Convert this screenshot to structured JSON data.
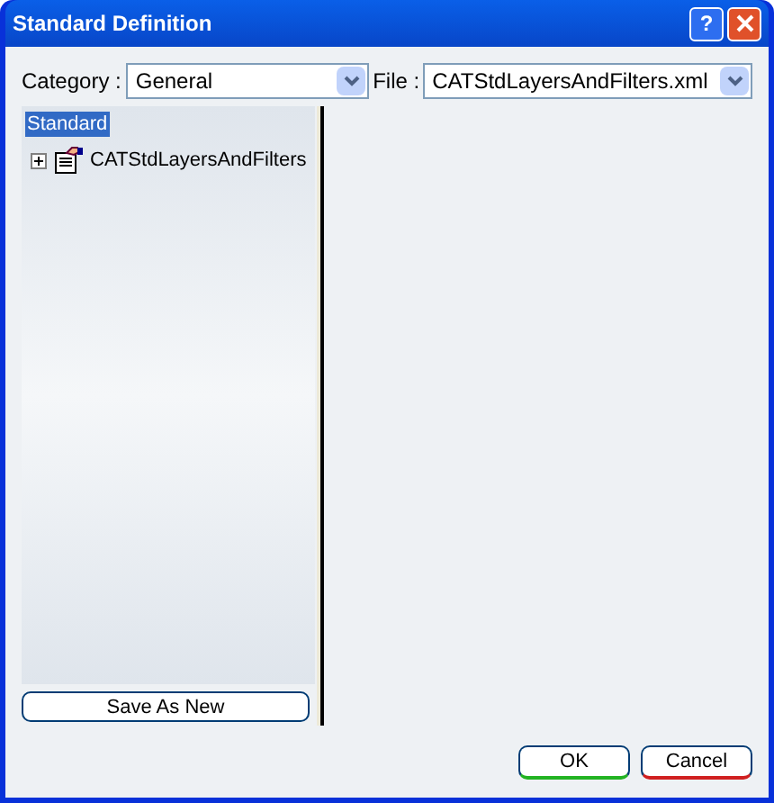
{
  "window": {
    "title": "Standard Definition",
    "help": "?"
  },
  "category": {
    "label": "Category :",
    "value": "General"
  },
  "file": {
    "label": "File :",
    "value": "CATStdLayersAndFilters.xml"
  },
  "tree": [
    {
      "label": "Standard",
      "selected": true,
      "children": [
        {
          "label": "CATStdLayersAndFilters",
          "selected": false,
          "expanded": false
        }
      ]
    }
  ],
  "save_button": "Save As New",
  "buttons": [
    {
      "label": "OK",
      "kind": "ok"
    },
    {
      "label": "Cancel",
      "kind": "cancel"
    }
  ]
}
